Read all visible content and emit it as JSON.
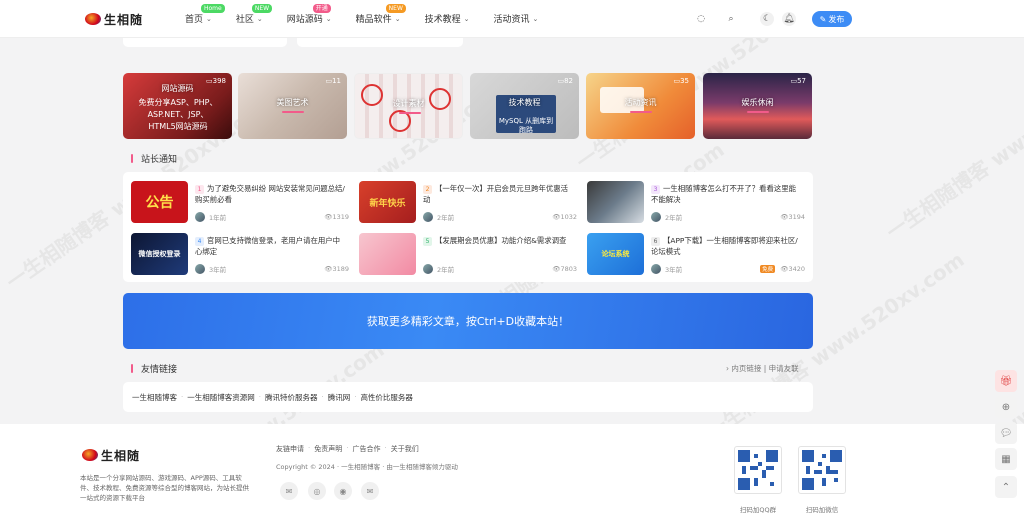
{
  "header": {
    "logo_text": "生相随",
    "nav": [
      {
        "label": "首页",
        "badge": "Home",
        "badge_color": "#4cd964"
      },
      {
        "label": "社区",
        "badge": "NEW",
        "badge_color": "#4cd964"
      },
      {
        "label": "网站源码",
        "badge": "开通",
        "badge_color": "#f25b8a"
      },
      {
        "label": "精品软件",
        "badge": "NEW",
        "badge_color": "#f59a23"
      },
      {
        "label": "技术教程",
        "badge": ""
      },
      {
        "label": "活动资讯",
        "badge": ""
      }
    ],
    "publish_label": "发布",
    "accent": "#3d8cf5"
  },
  "categories": [
    {
      "label": "网站源码",
      "count": "398",
      "sub": "免费分享ASP、PHP、ASP.NET、JSP、HTML5网站源码"
    },
    {
      "label": "美图艺术",
      "count": "11"
    },
    {
      "label": "设计素材",
      "count": ""
    },
    {
      "label": "技术教程",
      "count": "82",
      "sub": "MySQL 从删库到跑路"
    },
    {
      "label": "活动资讯",
      "count": "35"
    },
    {
      "label": "娱乐休闲",
      "count": "57"
    }
  ],
  "notices_title": "站长通知",
  "notices": [
    {
      "num": "1",
      "title": "为了避免交易纠纷 网站安装常见问题总结/购买前必看",
      "time": "1年前",
      "views": "1319",
      "thumb_text": "公告"
    },
    {
      "num": "2",
      "title": "【一年仅一次】开启会员元旦跨年优惠活动",
      "time": "2年前",
      "views": "1032",
      "thumb_text": "新年快乐"
    },
    {
      "num": "3",
      "title": "一生相随博客怎么打不开了？看看这里能不能解决",
      "time": "2年前",
      "views": "3194"
    },
    {
      "num": "4",
      "title": "官网已支持微信登录，老用户请在用户中心绑定",
      "time": "3年前",
      "views": "3189",
      "thumb_text": "微信授权登录"
    },
    {
      "num": "5",
      "title": "【发展期会员优惠】功能介绍&需求调查",
      "time": "2年前",
      "views": "7803"
    },
    {
      "num": "6",
      "title": "【APP下载】一生相随博客即将迎来社区/论坛模式",
      "time": "3年前",
      "views": "3420",
      "free_tag": "免费",
      "thumb_text": "论坛系统"
    }
  ],
  "banner_text": "获取更多精彩文章，按Ctrl+D收藏本站！",
  "links": {
    "title": "友情链接",
    "apply": "内页链接 | 申请友联",
    "items": [
      "一生相随博客",
      "一生相随博客资源网",
      "腾讯特价服务器",
      "腾讯网",
      "高性价比服务器"
    ]
  },
  "footer": {
    "desc": "本站是一个分享网站源码、游戏源码、APP源码、工具软件、技术教程、免费资源等综合型的博客网站，为站长提供一站式的资源下载平台",
    "links": [
      "友链申请",
      "免责声明",
      "广告合作",
      "关于我们"
    ],
    "copyright": "Copyright © 2024 · 一生相随博客 · 由一生相随博客倾力驱动",
    "qr_captions": [
      "扫码加QQ群",
      "扫码加微信"
    ]
  },
  "watermark": "一生相随博客 www.520xv.com"
}
